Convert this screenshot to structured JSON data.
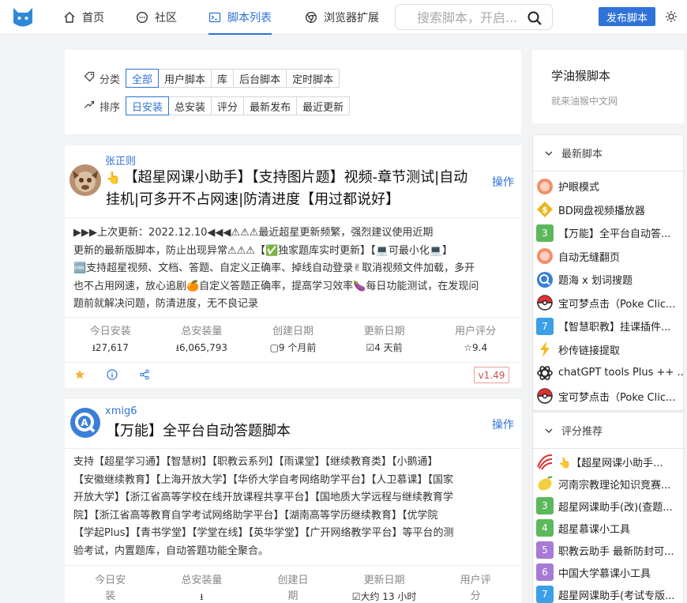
{
  "nav": {
    "home": "首页",
    "community": "社区",
    "scripts": "脚本列表",
    "extensions": "浏览器扩展",
    "search_placeholder": "搜索脚本，开启...",
    "publish": "发布脚本"
  },
  "filters": {
    "category_label": "分类",
    "categories": [
      "全部",
      "用户脚本",
      "库",
      "后台脚本",
      "定时脚本"
    ],
    "sort_label": "排序",
    "sorts": [
      "日安装",
      "总安装",
      "评分",
      "最新发布",
      "最近更新"
    ]
  },
  "site": {
    "title": "学油猴脚本",
    "subtitle": "就来油猴中文网"
  },
  "cards": [
    {
      "author": "张正则",
      "title": "【超星网课小助手】【支持图片题】视频-章节测试|自动挂机|可多开不占网速|防清进度【用过都说好】",
      "action": "操作",
      "desc_lines": [
        "▶▶▶上次更新：2022.12.10◀◀◀⚠⚠⚠最近超星更新频繁，强烈建议使用近期",
        "更新的最新版脚本，防止出现异常⚠⚠⚠【✅独家题库实时更新】【💻可最小化💻】",
        "🆒支持超星视频、文档、答题、自定义正确率、掉线自动登录✌取消视频文件加载，多开",
        "也不占用网速，放心追剧🍊自定义答题正确率，提高学习效率🍆每日功能测试，在发现问",
        "题前就解决问题，防清进度，无不良记录"
      ],
      "stats": [
        {
          "label": "今日安装",
          "value": "⭳27,617"
        },
        {
          "label": "总安装量",
          "value": "⭳6,065,793"
        },
        {
          "label": "创建日期",
          "value": "▢9 个月前"
        },
        {
          "label": "更新日期",
          "value": "☑4 天前"
        },
        {
          "label": "用户评分",
          "value": "☆9.4"
        }
      ],
      "version": "v1.49"
    },
    {
      "author": "xmig6",
      "title": "【万能】全平台自动答题脚本",
      "action": "操作",
      "desc_lines": [
        "支持【超星学习通】【智慧树】【职教云系列】【雨课堂】【继续教育类】【小鹅通】",
        "【安徽继续教育】【上海开放大学】【华侨大学自考网络助学平台】【人卫慕课】【国家",
        "开放大学】【浙江省高等学校在线开放课程共享平台】【国地质大学远程与继续教育学",
        "院】【浙江省高等教育自学考试网络助学平台】【湖南高等学历继续教育】【优学院",
        "【学起Plus】【青书学堂】【学堂在线】【英华学堂】【广开网络教学平台】等平台的测",
        "验考试，内置题库，自动答题功能全聚合。"
      ],
      "stats": [
        {
          "label": "今日安",
          "label2": "装"
        },
        {
          "label": "总安装量",
          "label2": "⭳"
        },
        {
          "label": "创建日",
          "label2": "期"
        },
        {
          "label": "更新日期",
          "label2": "☑大约 13 小时"
        },
        {
          "label": "用户评",
          "label2": "分"
        }
      ]
    }
  ],
  "latest": {
    "heading": "最新脚本",
    "items": [
      {
        "icon": "orange-avatar-icon",
        "label": "护眼模式"
      },
      {
        "icon": "dollar-diamond-icon",
        "label": "BD网盘视频播放器"
      },
      {
        "icon": "number-badge-icon",
        "badge": "3",
        "label": "【万能】全平台自动答..."
      },
      {
        "icon": "orange-avatar-icon",
        "label": "自动无缝翻页"
      },
      {
        "icon": "search-badge-icon",
        "label": "题海 x 划词搜题"
      },
      {
        "icon": "pokeball-icon",
        "label": "宝可梦点击（Poke Clic..."
      },
      {
        "icon": "number-badge-icon",
        "badge": "7",
        "label": "【智慧职教】挂课插件..."
      },
      {
        "icon": "lightning-icon",
        "label": "秒传链接提取"
      },
      {
        "icon": "openai-icon",
        "label": "chatGPT tools Plus ++ ..."
      },
      {
        "icon": "pokeball-icon",
        "label": "宝可梦点击（Poke Clic..."
      }
    ]
  },
  "rated": {
    "heading": "评分推荐",
    "items": [
      {
        "icon": "chaoxing-icon",
        "label": "👆【超星网课小助手..."
      },
      {
        "icon": "lemon-icon",
        "label": "河南宗教理论知识竞赛..."
      },
      {
        "icon": "number-badge-icon",
        "badge": "3",
        "label": "超星网课助手(改)(查题..."
      },
      {
        "icon": "number-badge-icon",
        "badge": "4",
        "label": "超星慕课小工具"
      },
      {
        "icon": "number-badge-icon",
        "badge": "5",
        "label": "职教云助手 最新防封可..."
      },
      {
        "icon": "number-badge-icon",
        "badge": "6",
        "label": "中国大学慕课小工具"
      },
      {
        "icon": "number-badge-icon",
        "badge": "7",
        "label": "超星网课助手(考试专版..."
      }
    ]
  }
}
